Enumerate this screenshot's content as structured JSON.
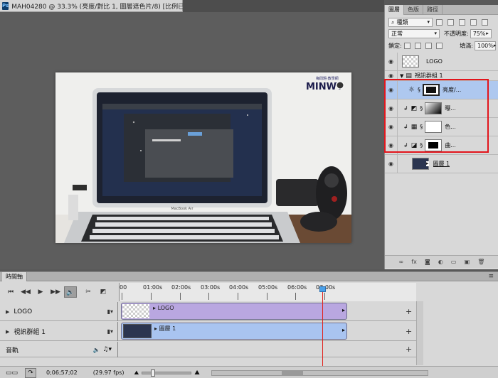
{
  "document": {
    "app_icon": "Ps",
    "tab_title": "MAH04280 @ 33.3% (亮度/對比 1, 圖層遮色片/8) [比例已校正] *"
  },
  "photo": {
    "brand": "MINWT",
    "brand_sub": "梅問題·教學網",
    "laptop_label": "MacBook Air"
  },
  "layers_panel": {
    "tabs": [
      "圖層",
      "色版",
      "路徑"
    ],
    "active_tab": 0,
    "filter_kind": "種類",
    "blend_mode": "正常",
    "opacity_label": "不透明度:",
    "opacity_value": "75%",
    "lock_label": "鎖定:",
    "fill_label": "填滿:",
    "fill_value": "100%",
    "layers": [
      {
        "name": "LOGO",
        "type": "pixel"
      },
      {
        "name": "視訊群組 1",
        "type": "group"
      },
      {
        "name": "亮度/...",
        "type": "adjustment",
        "adj_icon": "sun-icon",
        "selected": true
      },
      {
        "name": "曝...",
        "type": "adjustment",
        "adj_icon": "exposure-icon"
      },
      {
        "name": "色...",
        "type": "adjustment",
        "adj_icon": "hue-icon"
      },
      {
        "name": "曲...",
        "type": "adjustment",
        "adj_icon": "curves-icon"
      },
      {
        "name": "圖層 1",
        "type": "video"
      }
    ],
    "bottom_icons": [
      "link-icon",
      "fx-icon",
      "mask-icon",
      "adjustment-icon",
      "folder-icon",
      "new-layer-icon",
      "trash-icon"
    ]
  },
  "timeline": {
    "title": "時間軸",
    "ruler": [
      "00",
      "01:00s",
      "02:00s",
      "03:00s",
      "04:00s",
      "05:00s",
      "06:00s",
      "07:00s"
    ],
    "tracks": [
      {
        "label": "LOGO",
        "clip_name": "LOGO"
      },
      {
        "label": "視訊群組 1",
        "clip_name": "圖層 1"
      },
      {
        "label": "音軌"
      }
    ],
    "timecode": "0;06;57;02",
    "fps": "(29.97 fps)"
  },
  "colors": {
    "selection_highlight": "#aec8ef",
    "annotation_red": "#e2151c",
    "clip_purple": "#b9a7e0",
    "clip_blue": "#a9c4f0",
    "playhead": "#e0241f"
  }
}
